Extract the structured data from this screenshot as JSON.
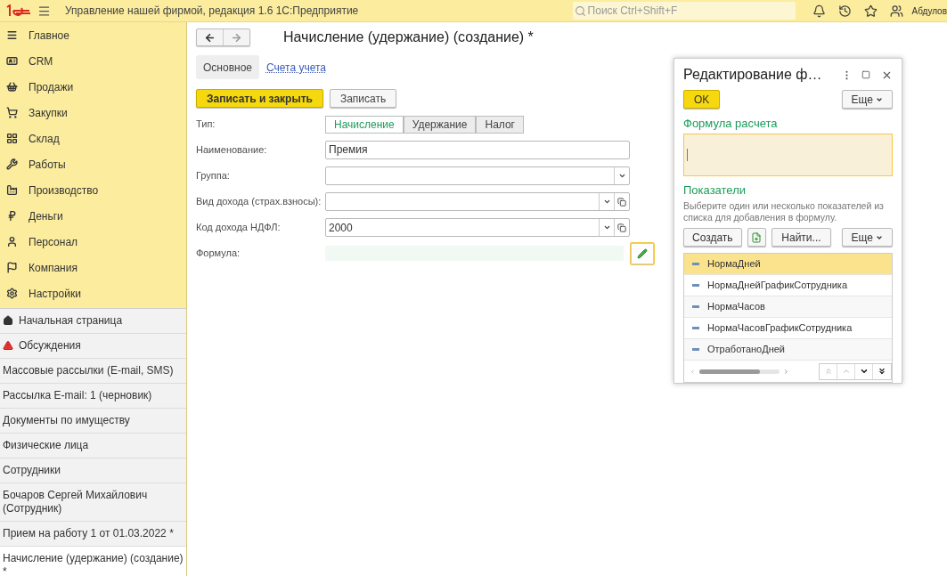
{
  "topbar": {
    "app_title": "Управление нашей фирмой, редакция 1.6 1С:Предприятие",
    "search_placeholder": "Поиск Ctrl+Shift+F",
    "user": "Абдулов"
  },
  "sections": [
    {
      "label": "Главное"
    },
    {
      "label": "CRM"
    },
    {
      "label": "Продажи"
    },
    {
      "label": "Закупки"
    },
    {
      "label": "Склад"
    },
    {
      "label": "Работы"
    },
    {
      "label": "Производство"
    },
    {
      "label": "Деньги"
    },
    {
      "label": "Персонал"
    },
    {
      "label": "Компания"
    },
    {
      "label": "Настройки"
    }
  ],
  "open_windows": [
    {
      "label": "Начальная страница",
      "selected": false
    },
    {
      "label": "Обсуждения",
      "selected": false
    },
    {
      "label": "Массовые рассылки (E-mail, SMS)",
      "selected": false
    },
    {
      "label": "Рассылка E-mail: 1  (черновик)",
      "selected": false
    },
    {
      "label": "Документы по имуществу",
      "selected": false
    },
    {
      "label": "Физические лица",
      "selected": false
    },
    {
      "label": "Сотрудники",
      "selected": false
    },
    {
      "label": "Бочаров Сергей Михайлович (Сотрудник)",
      "selected": false
    },
    {
      "label": "Прием на работу 1 от 01.03.2022 *",
      "selected": false
    },
    {
      "label": "Начисление (удержание) (создание) *",
      "selected": true
    }
  ],
  "form": {
    "title": "Начисление (удержание) (создание) *",
    "tabs": [
      {
        "label": "Основное",
        "selected": true
      },
      {
        "label": "Счета учета",
        "selected": false
      }
    ],
    "buttons": [
      {
        "label": "Записать и закрыть",
        "kind": "primary"
      },
      {
        "label": "Записать",
        "kind": "default"
      }
    ],
    "type_label": "Тип:",
    "type_options": [
      {
        "label": "Начисление",
        "selected": true
      },
      {
        "label": "Удержание",
        "selected": false
      },
      {
        "label": "Налог",
        "selected": false
      }
    ],
    "fields": [
      {
        "label": "Наименование:",
        "value": "Премия",
        "kind": "text"
      },
      {
        "label": "Группа:",
        "kind": "select"
      },
      {
        "label": "Вид дохода (страх.взносы):",
        "kind": "select-open"
      },
      {
        "label": "Код дохода НДФЛ:",
        "value": "2000",
        "kind": "select-open"
      },
      {
        "label": "Формула:",
        "kind": "formula"
      }
    ]
  },
  "dialog": {
    "title": "Редактирование ф…",
    "ok": "OK",
    "more": "Еще",
    "formula_heading": "Формула расчета",
    "indicators_heading": "Показатели",
    "hint": "Выберите один или несколько показателей из списка для добавления в формулу.",
    "create": "Создать",
    "find": "Найти...",
    "more2": "Еще",
    "indicators": [
      {
        "label": "НормаДней",
        "selected": true
      },
      {
        "label": "НормаДнейГрафикСотрудника",
        "selected": false
      },
      {
        "label": "НормаЧасов",
        "selected": false
      },
      {
        "label": "НормаЧасовГрафикСотрудника",
        "selected": false
      },
      {
        "label": "ОтработаноДней",
        "selected": false
      }
    ]
  }
}
